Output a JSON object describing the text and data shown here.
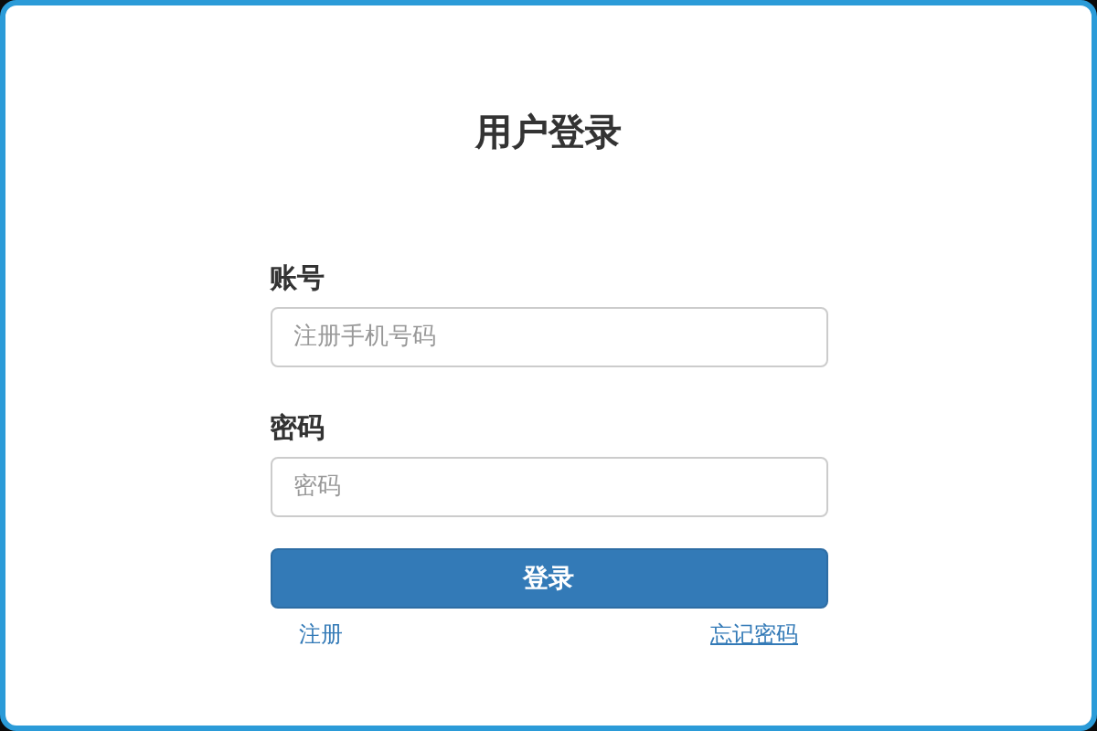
{
  "title": "用户登录",
  "fields": [
    {
      "label": "账号",
      "placeholder": "注册手机号码"
    },
    {
      "label": "密码",
      "placeholder": "密码"
    }
  ],
  "submit_button": "登录",
  "links": [
    {
      "label": "注册",
      "underlined": false
    },
    {
      "label": "忘记密码",
      "underlined": true
    }
  ]
}
